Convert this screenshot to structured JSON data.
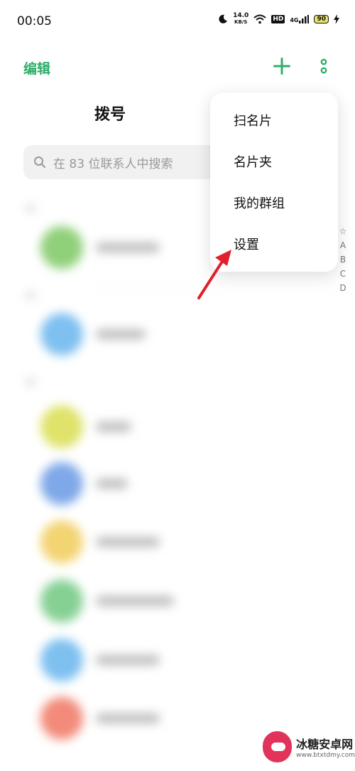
{
  "status_bar": {
    "time": "00:05",
    "net_speed_value": "14.0",
    "net_speed_unit": "KB/S",
    "hd_label": "HD",
    "signal_label": "4G",
    "battery": "90"
  },
  "toolbar": {
    "edit_label": "编辑",
    "add_icon": "plus-icon",
    "more_icon": "more-vertical-icon"
  },
  "page": {
    "title": "拨号"
  },
  "search": {
    "placeholder": "在 83 位联系人中搜索"
  },
  "menu": {
    "items": [
      {
        "label": "扫名片"
      },
      {
        "label": "名片夹"
      },
      {
        "label": "我的群组"
      },
      {
        "label": "设置"
      }
    ]
  },
  "alphabet_index": [
    "☆",
    "A",
    "B",
    "C",
    "D"
  ],
  "contacts": {
    "avatar_colors": [
      "#8fd07a",
      "#7ec0f0",
      "#dfe36a",
      "#7ea8e8",
      "#f3d473",
      "#86d093",
      "#7ec0f0",
      "#f28b7a"
    ]
  },
  "watermark": {
    "name": "冰糖安卓网",
    "url": "www.btxtdmy.com"
  }
}
